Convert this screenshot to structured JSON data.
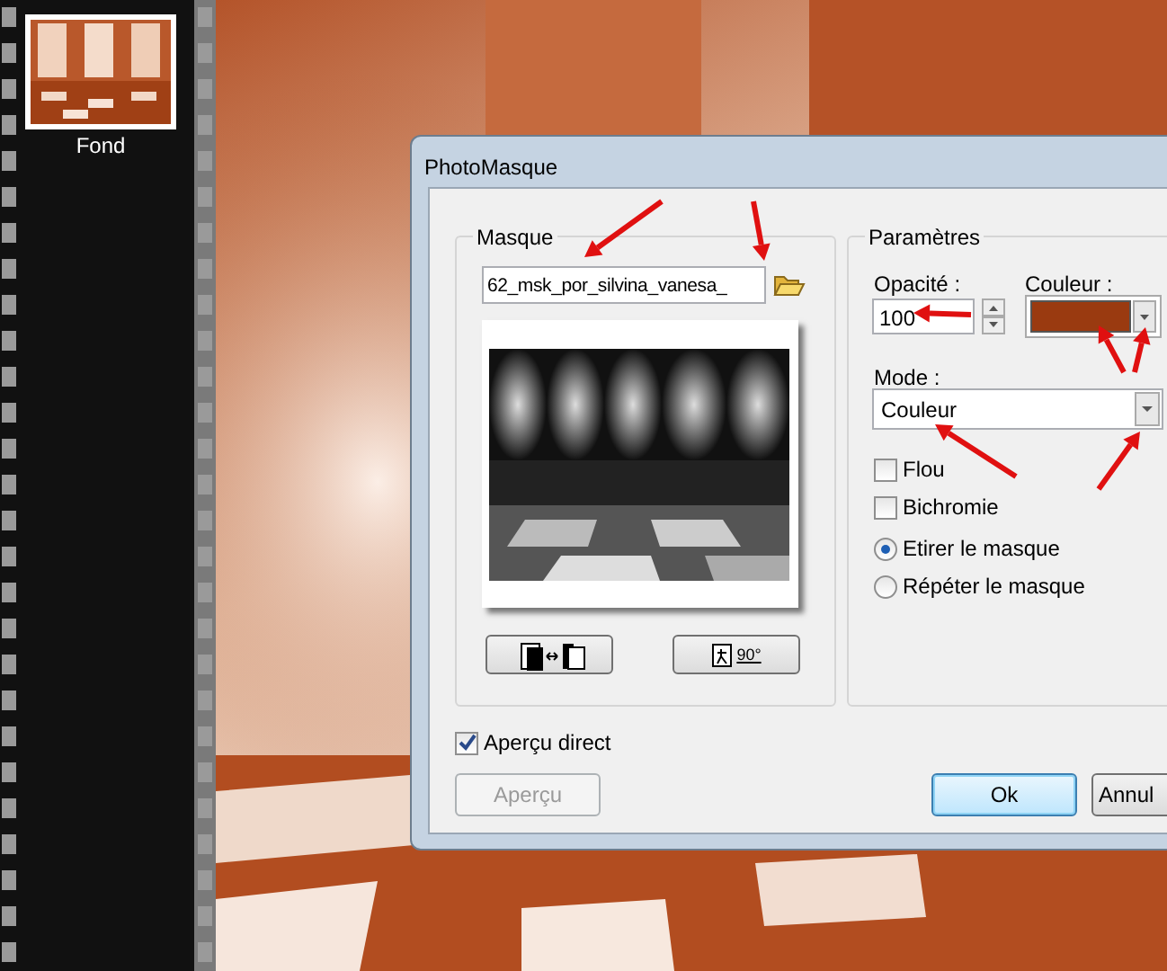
{
  "filmstrip": {
    "thumbnails": [
      {
        "label": "Fond",
        "selected": true
      }
    ]
  },
  "dialog": {
    "title": "PhotoMasque",
    "mask_group": {
      "title": "Masque",
      "file": "62_msk_por_silvina_vanesa_",
      "rotate_label": "90°"
    },
    "params_group": {
      "title": "Paramètres",
      "opacity_label": "Opacité :",
      "opacity": "100",
      "color_label": "Couleur :",
      "color": "#9a3a10",
      "mode_label": "Mode :",
      "mode": "Couleur",
      "checkboxes": [
        {
          "label": "Flou",
          "checked": false
        },
        {
          "label": "Bichromie",
          "checked": false
        }
      ],
      "radios": [
        {
          "label": "Etirer le masque",
          "selected": true
        },
        {
          "label": "Répéter le masque",
          "selected": false
        }
      ]
    },
    "live_preview": {
      "label": "Aperçu direct",
      "checked": true
    },
    "buttons": [
      {
        "label": "Aperçu",
        "disabled": true,
        "default": false
      },
      {
        "label": "Ok",
        "disabled": false,
        "default": true
      },
      {
        "label": "Annul",
        "disabled": false,
        "default": false
      }
    ]
  }
}
